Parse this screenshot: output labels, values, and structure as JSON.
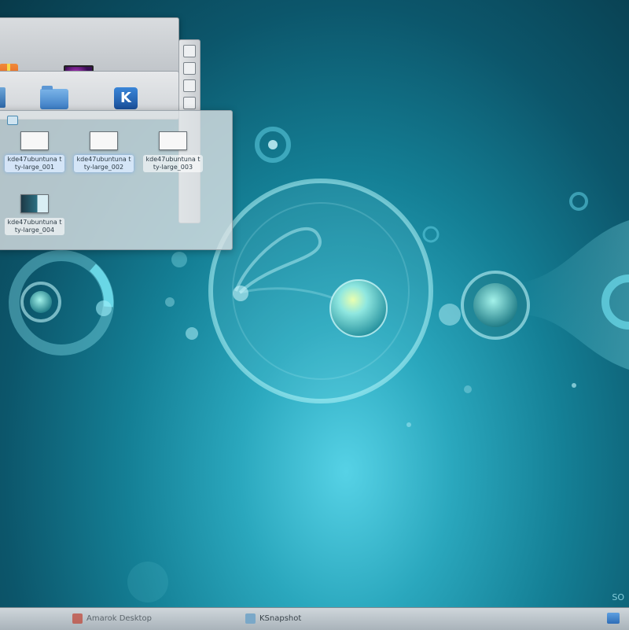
{
  "desktop": {
    "watermark": "SO"
  },
  "folder_back": {
    "icons": [
      "gift-icon",
      "media-icon"
    ]
  },
  "folder_mid": {
    "icons": [
      "document-icon",
      "folder-icon",
      "kde-icon"
    ],
    "kde_glyph": "K"
  },
  "folder_front": {
    "files": [
      {
        "name": "kde47ubuntuna tty-large_001",
        "selected": true
      },
      {
        "name": "kde47ubuntuna tty-large_002",
        "selected": true
      },
      {
        "name": "kde47ubuntuna tty-large_003",
        "selected": false
      },
      {
        "name": "kde47ubuntuna tty-large_004",
        "selected": false
      }
    ]
  },
  "taskbar": {
    "tasks": [
      {
        "label": "Amarok Desktop",
        "icon": "app-icon"
      },
      {
        "label": "KSnapshot",
        "icon": "camera-icon"
      }
    ],
    "tray_icon": "network-icon"
  },
  "colors": {
    "wallpaper_center": "#56d2e6",
    "wallpaper_edge": "#083a4a",
    "taskbar": "#cfd6db",
    "selection": "#d7e8fc"
  }
}
